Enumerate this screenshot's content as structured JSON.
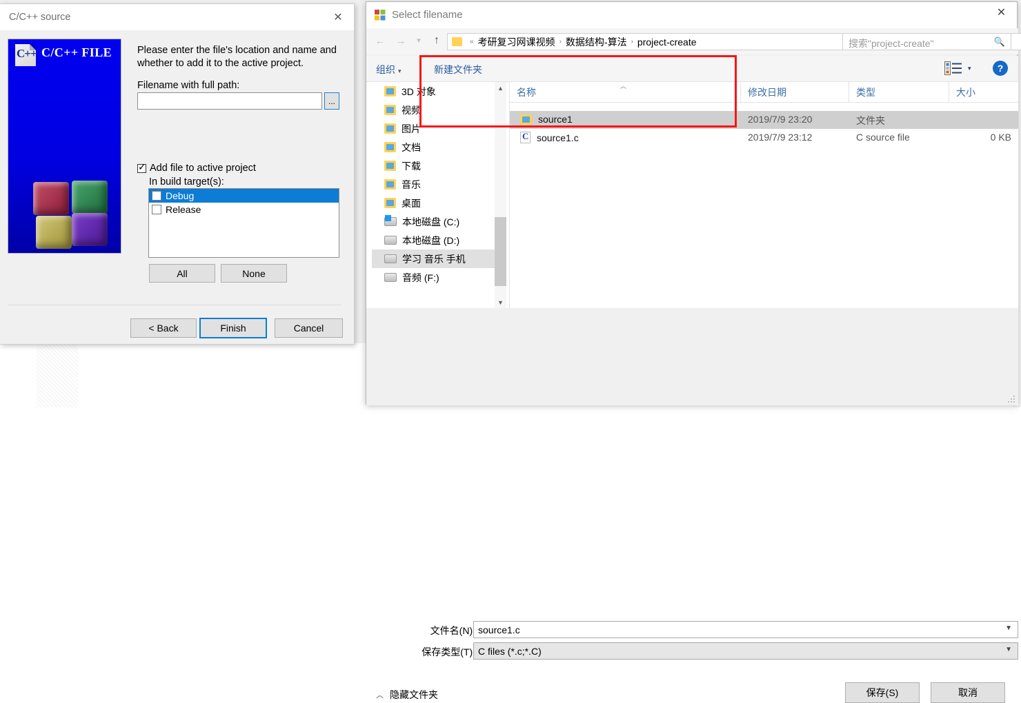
{
  "wizard": {
    "title": "C/C++ source",
    "close_icon": "close-icon",
    "banner": {
      "icon_text": "C++",
      "label": "C/C++ FILE"
    },
    "instruction": "Please enter the file's location and name and whether to add it to the active project.",
    "filename_label": "Filename with full path:",
    "filename_value": "",
    "browse_label": "...",
    "add_file_label": "Add file to active project",
    "add_file_checked": true,
    "build_targets_label": "In build target(s):",
    "targets": [
      {
        "label": "Debug",
        "checked": false,
        "selected": true
      },
      {
        "label": "Release",
        "checked": false,
        "selected": false
      }
    ],
    "all_label": "All",
    "none_label": "None",
    "back_label": "< Back",
    "finish_label": "Finish",
    "cancel_label": "Cancel",
    "accent": "#0c7cd5"
  },
  "explorer": {
    "title": "Select filename",
    "close_icon": "close-icon",
    "nav": {
      "back_icon": "arrow-left-icon",
      "forward_icon": "arrow-right-icon",
      "recent_icon": "chevron-down-icon",
      "up_icon": "arrow-up-icon"
    },
    "breadcrumb": {
      "overflow": "«",
      "separator": "›",
      "items": [
        "考研复习网课视频",
        "数据结构-算法",
        "project-create"
      ],
      "dropdown_icon": "chevron-down-icon",
      "refresh_icon": "refresh-icon"
    },
    "search": {
      "placeholder": "搜索\"project-create\"",
      "icon": "search-icon"
    },
    "toolbar": {
      "organize_label": "组织",
      "organize_caret": "▾",
      "new_folder_label": "新建文件夹",
      "view_icon": "view-options-icon",
      "view_caret": "▾",
      "help_label": "?"
    },
    "sidebar": [
      {
        "label": "3D 对象",
        "icon": "folder-icon",
        "selected": false
      },
      {
        "label": "视频",
        "icon": "folder-icon",
        "selected": false
      },
      {
        "label": "图片",
        "icon": "folder-icon",
        "selected": false
      },
      {
        "label": "文档",
        "icon": "folder-icon",
        "selected": false
      },
      {
        "label": "下载",
        "icon": "folder-icon",
        "selected": false
      },
      {
        "label": "音乐",
        "icon": "folder-icon",
        "selected": false
      },
      {
        "label": "桌面",
        "icon": "folder-icon",
        "selected": false
      },
      {
        "label": "本地磁盘 (C:)",
        "icon": "drive-windows-icon",
        "selected": false
      },
      {
        "label": "本地磁盘 (D:)",
        "icon": "drive-icon",
        "selected": false
      },
      {
        "label": "学习 音乐 手机",
        "icon": "drive-icon",
        "selected": true
      },
      {
        "label": "音频 (F:)",
        "icon": "drive-icon",
        "selected": false
      }
    ],
    "scrollbar": {
      "up_icon": "chevron-up-icon",
      "down_icon": "chevron-down-icon"
    },
    "columns": [
      {
        "key": "name",
        "label": "名称",
        "sort_icon": "sort-ascending-icon"
      },
      {
        "key": "date",
        "label": "修改日期"
      },
      {
        "key": "type",
        "label": "类型"
      },
      {
        "key": "size",
        "label": "大小"
      }
    ],
    "files": [
      {
        "name": "source1",
        "date": "2019/7/9 23:20",
        "type": "文件夹",
        "size": "",
        "icon": "folder-icon",
        "selected": true
      },
      {
        "name": "source1.c",
        "date": "2019/7/9 23:12",
        "type": "C source file",
        "size": "0 KB",
        "icon": "c-file-icon",
        "selected": false
      }
    ],
    "filename_label": "文件名(N):",
    "filename_value": "source1.c",
    "savetype_label": "保存类型(T):",
    "savetype_value": "C files (*.c;*.C)",
    "hide_folders_label": "隐藏文件夹",
    "hide_folders_icon": "chevron-up-icon",
    "save_label": "保存(S)",
    "cancel_label": "取消",
    "resize_grip_icon": "resize-grip-icon"
  },
  "annotation": {
    "color": "#fb1414",
    "shape": "rectangle"
  }
}
